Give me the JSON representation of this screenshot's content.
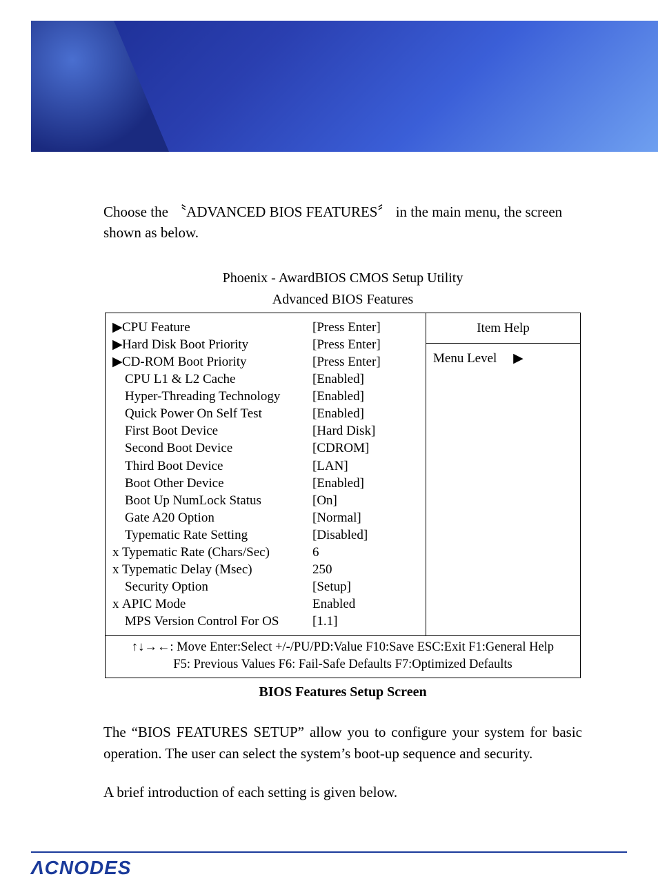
{
  "intro_text": "Choose the 〝ADVANCED BIOS FEATURES〞 in  the main menu, the screen shown as below.",
  "bios": {
    "title": "Phoenix - AwardBIOS CMOS Setup Utility",
    "subtitle": "Advanced BIOS Features",
    "help_heading": "Item Help",
    "help_body_label": "Menu Level",
    "help_body_arrow": "▶",
    "rows": [
      {
        "prefix": "▶",
        "label": "CPU Feature",
        "value": "[Press Enter]",
        "indent": "indent0"
      },
      {
        "prefix": "▶",
        "label": "Hard Disk Boot Priority",
        "value": "[Press Enter]",
        "indent": "indent0"
      },
      {
        "prefix": "▶",
        "label": "CD-ROM Boot Priority",
        "value": "[Press Enter]",
        "indent": "indent0"
      },
      {
        "prefix": "",
        "label": "CPU L1 & L2 Cache",
        "value": "[Enabled]",
        "indent": "indent1"
      },
      {
        "prefix": "",
        "label": "Hyper-Threading Technology",
        "value": "[Enabled]",
        "indent": "indent1"
      },
      {
        "prefix": "",
        "label": "Quick Power On Self Test",
        "value": "[Enabled]",
        "indent": "indent1"
      },
      {
        "prefix": "",
        "label": "First Boot Device",
        "value": "[Hard Disk]",
        "indent": "indent1"
      },
      {
        "prefix": "",
        "label": "Second Boot Device",
        "value": "[CDROM]",
        "indent": "indent1"
      },
      {
        "prefix": "",
        "label": "Third Boot Device",
        "value": "[LAN]",
        "indent": "indent1"
      },
      {
        "prefix": "",
        "label": "Boot Other Device",
        "value": "[Enabled]",
        "indent": "indent1"
      },
      {
        "prefix": "",
        "label": "Boot Up NumLock Status",
        "value": "[On]",
        "indent": "indent1"
      },
      {
        "prefix": "",
        "label": "Gate A20 Option",
        "value": "[Normal]",
        "indent": "indent1"
      },
      {
        "prefix": "",
        "label": "Typematic Rate Setting",
        "value": "[Disabled]",
        "indent": "indent1"
      },
      {
        "prefix": "x",
        "label": "Typematic Rate (Chars/Sec)",
        "value": "6",
        "indent": "indent0"
      },
      {
        "prefix": "x",
        "label": "Typematic Delay (Msec)",
        "value": "250",
        "indent": "indent0"
      },
      {
        "prefix": "",
        "label": "Security Option",
        "value": "[Setup]",
        "indent": "indent1"
      },
      {
        "prefix": "x",
        "label": "APIC Mode",
        "value": "Enabled",
        "indent": "indent0"
      },
      {
        "prefix": "",
        "label": "MPS Version Control For OS",
        "value": "[1.1]",
        "indent": "indent1"
      }
    ],
    "footer_line1": "↑↓→←: Move   Enter:Select   +/-/PU/PD:Value   F10:Save   ESC:Exit   F1:General Help",
    "footer_line2": "F5: Previous Values      F6: Fail-Safe Defaults     F7:Optimized Defaults"
  },
  "caption": "BIOS Features Setup Screen",
  "para1": "The “BIOS FEATURES SETUP” allow you to configure your system for basic operation.    The user can select the system’s boot-up sequence and security.",
  "para2": "A brief introduction of each setting is given below.",
  "logo_text": "ΛCNODES"
}
